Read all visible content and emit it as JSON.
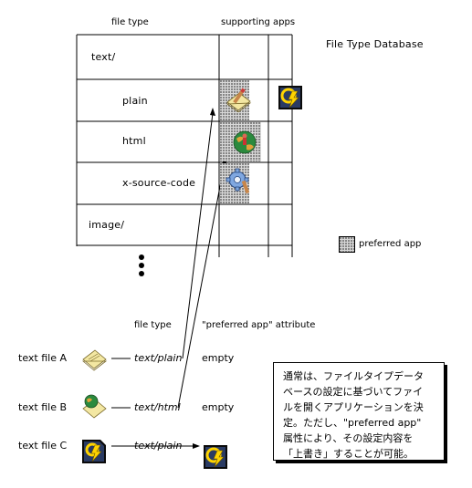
{
  "headers": {
    "file_type": "file type",
    "supporting_apps": "supporting apps"
  },
  "database_title": "File Type Database",
  "rows": [
    {
      "label": "text/"
    },
    {
      "label": "plain"
    },
    {
      "label": "html"
    },
    {
      "label": "x-source-code"
    },
    {
      "label": "image/"
    }
  ],
  "legend": {
    "label": "preferred app"
  },
  "files_header": {
    "file_type": "file type",
    "preferred_attr": "\"preferred app\" attribute"
  },
  "files": [
    {
      "name": "text file A",
      "type": "text/plain",
      "attr": "empty"
    },
    {
      "name": "text file B",
      "type": "text/html",
      "attr": "empty"
    },
    {
      "name": "text file C",
      "type": "text/plain",
      "attr": ""
    }
  ],
  "note": [
    "通常は、ファイルタイプデータ",
    "ベースの設定に基づいてファイ",
    "ルを開くアプリケーションを決",
    "定。ただし、\"preferred app\"",
    "属性により、その設定内容を",
    "「上書き」することが可能。"
  ],
  "icons": {
    "text_app": "pen-paper-icon",
    "power_app": "lightning-app-icon",
    "web_app": "globe-figure-icon",
    "code_app": "gear-pencil-icon",
    "doc_icon": "document-icon",
    "web_doc_icon": "globe-document-icon"
  }
}
